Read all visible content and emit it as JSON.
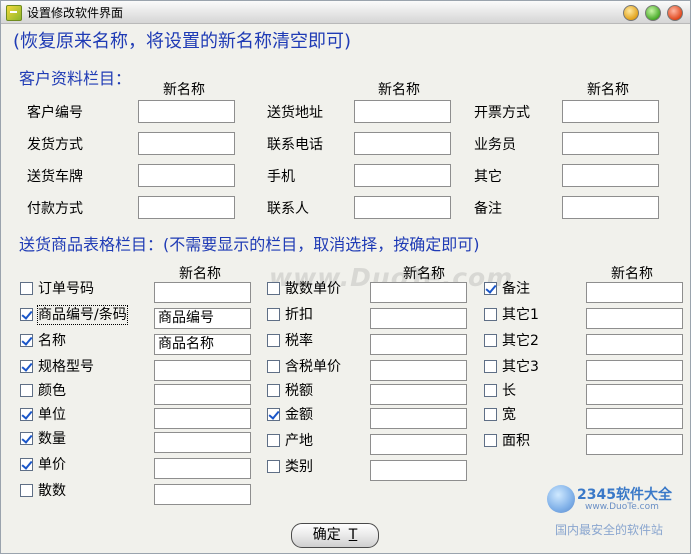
{
  "window": {
    "title": "设置修改软件界面"
  },
  "hint": "(恢复原来名称，将设置的新名称清空即可)",
  "customer": {
    "section": "客户资料栏目：",
    "new_name_header": "新名称",
    "fields": [
      {
        "label": "客户编号",
        "value": ""
      },
      {
        "label": "发货方式",
        "value": ""
      },
      {
        "label": "送货车牌",
        "value": ""
      },
      {
        "label": "付款方式",
        "value": ""
      },
      {
        "label": "送货地址",
        "value": ""
      },
      {
        "label": "联系电话",
        "value": ""
      },
      {
        "label": "手机",
        "value": ""
      },
      {
        "label": "联系人",
        "value": ""
      },
      {
        "label": "开票方式",
        "value": ""
      },
      {
        "label": "业务员",
        "value": ""
      },
      {
        "label": "其它",
        "value": ""
      },
      {
        "label": "备注",
        "value": ""
      }
    ]
  },
  "goods": {
    "section": "送货商品表格栏目：(不需要显示的栏目，取消选择，按确定即可)",
    "new_name_header": "新名称",
    "col1": [
      {
        "label": "订单号码",
        "checked": false,
        "value": ""
      },
      {
        "label": "商品编号/条码",
        "checked": true,
        "value": "商品编号"
      },
      {
        "label": "名称",
        "checked": true,
        "value": "商品名称"
      },
      {
        "label": "规格型号",
        "checked": true,
        "value": ""
      },
      {
        "label": "颜色",
        "checked": false,
        "value": ""
      },
      {
        "label": "单位",
        "checked": true,
        "value": ""
      },
      {
        "label": "数量",
        "checked": true,
        "value": ""
      },
      {
        "label": "单价",
        "checked": true,
        "value": ""
      },
      {
        "label": "散数",
        "checked": false,
        "value": ""
      }
    ],
    "col2": [
      {
        "label": "散数单价",
        "checked": false,
        "value": ""
      },
      {
        "label": "折扣",
        "checked": false,
        "value": ""
      },
      {
        "label": "税率",
        "checked": false,
        "value": ""
      },
      {
        "label": "含税单价",
        "checked": false,
        "value": ""
      },
      {
        "label": "税额",
        "checked": false,
        "value": ""
      },
      {
        "label": "金额",
        "checked": true,
        "value": ""
      },
      {
        "label": "产地",
        "checked": false,
        "value": ""
      },
      {
        "label": "类别",
        "checked": false,
        "value": ""
      }
    ],
    "col3": [
      {
        "label": "备注",
        "checked": true,
        "value": ""
      },
      {
        "label": "其它1",
        "checked": false,
        "value": ""
      },
      {
        "label": "其它2",
        "checked": false,
        "value": ""
      },
      {
        "label": "其它3",
        "checked": false,
        "value": ""
      },
      {
        "label": "长",
        "checked": false,
        "value": ""
      },
      {
        "label": "宽",
        "checked": false,
        "value": ""
      },
      {
        "label": "面积",
        "checked": false,
        "value": ""
      }
    ]
  },
  "ok_button": {
    "label": "确定",
    "mnemonic": "T"
  },
  "watermark": "www.DuoTe.com",
  "logo": {
    "number": "2345软件大全",
    "url": "www.DuoTe.com",
    "footer": "国内最安全的软件站"
  },
  "colors": {
    "accent_text": "#1f3bb5",
    "window_bg": "#f1f1ec",
    "checkbox_check": "#1a56c9"
  }
}
